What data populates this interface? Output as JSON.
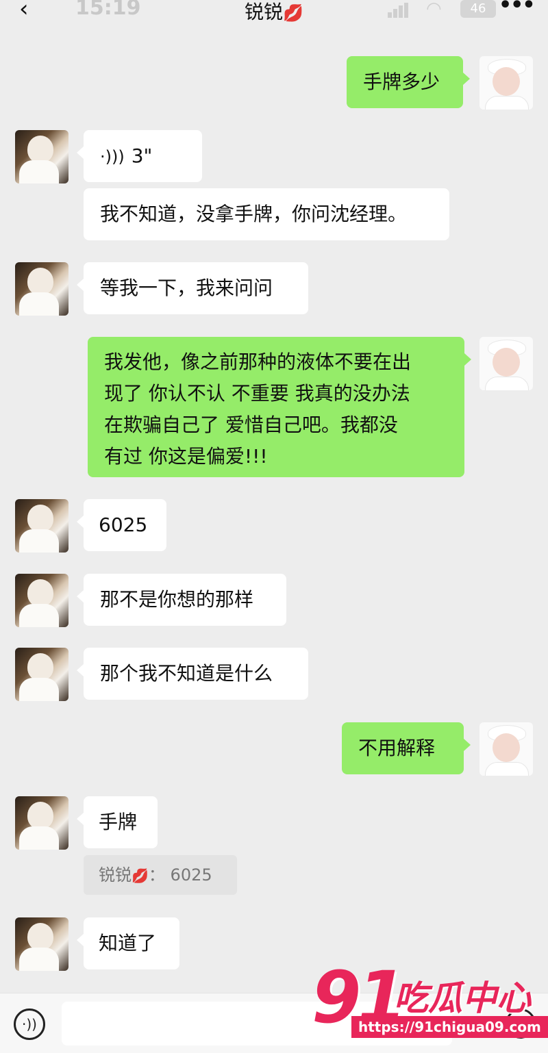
{
  "status": {
    "time": "15:19",
    "battery": "46"
  },
  "header": {
    "title": "锐锐",
    "title_emoji": "💋",
    "back_icon": "chevron-left-icon",
    "more_label": "•••"
  },
  "messages": [
    {
      "side": "out",
      "text": "手牌多少"
    },
    {
      "side": "in",
      "type": "voice",
      "text": "3\""
    },
    {
      "side": "in",
      "text": "我不知道，没拿手牌，你问沈经理。"
    },
    {
      "side": "in",
      "text": "等我一下，我来问问"
    },
    {
      "side": "out",
      "lines": [
        "我发他，像之前那种的液体不要在出",
        "现了 你认不认 不重要 我真的没办法",
        "在欺骗自己了 爱惜自己吧。我都没",
        "有过 你这是偏爱!!!"
      ]
    },
    {
      "side": "in",
      "text": "6025"
    },
    {
      "side": "in",
      "text": "那不是你想的那样"
    },
    {
      "side": "in",
      "text": "那个我不知道是什么"
    },
    {
      "side": "out",
      "text": "不用解释"
    },
    {
      "side": "in",
      "text": "手牌"
    },
    {
      "side": "in",
      "text": "知道了"
    }
  ],
  "quote": {
    "name": "锐锐",
    "emoji": "💋",
    "sep": "：",
    "text": "6025"
  },
  "watermark": {
    "number": "91",
    "text": "吃瓜中心",
    "url": "https://91chigua09.com"
  },
  "input": {
    "voice_icon": "voice-icon",
    "plus_icon": "+"
  }
}
